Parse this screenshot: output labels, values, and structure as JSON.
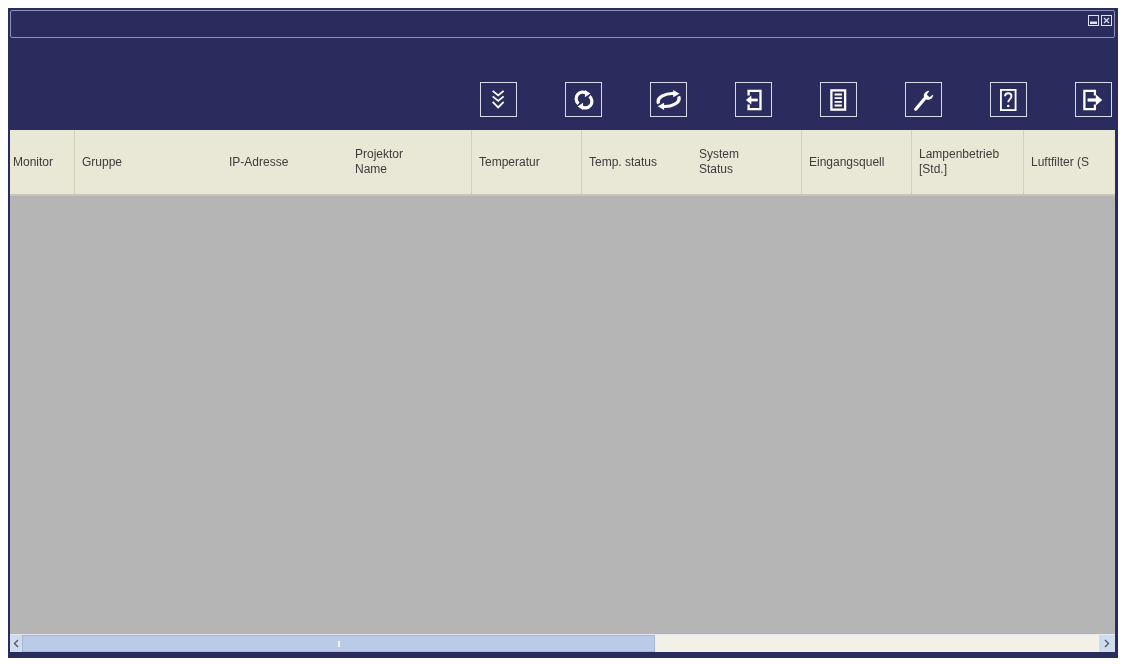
{
  "table": {
    "columns": [
      "Monitor",
      "Gruppe",
      "IP-Adresse",
      "Projektor\nName",
      "Temperatur",
      "Temp. status",
      "System\nStatus",
      "Eingangsquell",
      "Lampenbetrieb\n[Std.]",
      "Luftfilter (S"
    ]
  }
}
